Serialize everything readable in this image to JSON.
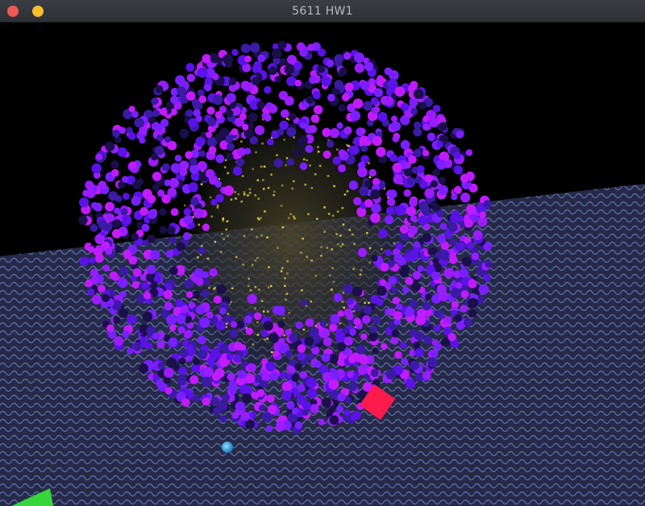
{
  "window": {
    "title": "5611 HW1",
    "buttons": [
      "close",
      "minimize"
    ]
  },
  "scene": {
    "background": "#000000",
    "floor_color": "#2b2f52",
    "floor_pattern_color": "#5a6aa0",
    "particle_colors": [
      "#7a1fff",
      "#9a1cff",
      "#c21bff",
      "#5a12e6",
      "#3b1aa6",
      "#1a0f4a"
    ],
    "inner_particle_color": "#d8d040",
    "emitter_color": "#ff1a4e",
    "ball_color": "#2aa6e6",
    "marker_color": "#38d43c"
  }
}
